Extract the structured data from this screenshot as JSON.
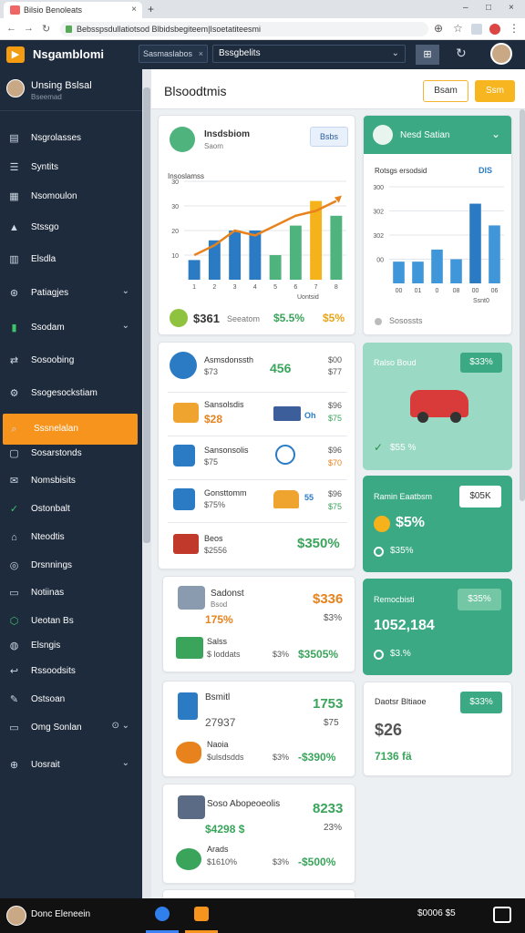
{
  "browser": {
    "tab_title": "Bilsio Benoleats",
    "tab_close": "×",
    "new_tab": "+",
    "url": "Bebsspsdullatiotsod Blbidsbegiteem|Isoetatiteesmi",
    "win_min": "–",
    "win_max": "□",
    "win_close": "×"
  },
  "appbar": {
    "app_name": "Nsgamblomi",
    "select1_value": "Sasmaslabos",
    "select1_clear": "×",
    "select2_value": "Bssgbelits"
  },
  "sidebar": {
    "user_name": "Unsing Bslsal",
    "user_sub": "Bseemad",
    "items": [
      {
        "label": "Nsgrolasses",
        "icon": "document-icon"
      },
      {
        "label": "Syntits",
        "icon": "list-icon"
      },
      {
        "label": "Nsomoulon",
        "icon": "clipboard-icon"
      },
      {
        "label": "Stssgo",
        "icon": "warning-icon"
      },
      {
        "label": "Elsdla",
        "icon": "calendar-icon"
      },
      {
        "label": "Patiagjes",
        "icon": "globe-icon",
        "chevron": "⌄"
      },
      {
        "label": "Ssodam",
        "icon": "chart-icon",
        "chevron": "⌄"
      },
      {
        "label": "Sosoobing",
        "icon": "transfer-icon"
      },
      {
        "label": "Ssogesockstiam",
        "icon": "settings-icon"
      },
      {
        "label": "Sssnelalan",
        "icon": "search-icon"
      },
      {
        "label": "Sosarstonds",
        "icon": "folder-icon"
      },
      {
        "label": "Nomsbisits",
        "icon": "message-icon"
      },
      {
        "label": "Ostonbalt",
        "icon": "check-icon"
      },
      {
        "label": "Nteodtis",
        "icon": "home-icon"
      },
      {
        "label": "Drsnnings",
        "icon": "pin-icon"
      },
      {
        "label": "Notiinas",
        "icon": "monitor-icon"
      },
      {
        "label": "Ueotan Bs",
        "icon": "shield-icon"
      },
      {
        "label": "Elsngis",
        "icon": "target-icon"
      },
      {
        "label": "Rssoodsits",
        "icon": "back-icon"
      },
      {
        "label": "Ostsoan",
        "icon": "pen-icon"
      },
      {
        "label": "Omg Sonlan",
        "icon": "monitor-icon",
        "chevron": "⊙ ⌄"
      },
      {
        "label": "Uosrait",
        "icon": "plus-icon",
        "chevron": "⌄"
      }
    ]
  },
  "header": {
    "title": "Blsoodtmis",
    "btn_outline": "Bsam",
    "btn_fill": "Ssm"
  },
  "chart_card": {
    "title": "Insdsbiom",
    "subtitle": "Saom",
    "button": "Bsbs",
    "chart_label": "Insoslamss",
    "foot_value": "$361",
    "foot_label": "Seeatom",
    "foot_green": "$5.5%",
    "foot_orange": "$5%",
    "x_caption": "Uontsid"
  },
  "chart_data": [
    {
      "type": "bar",
      "categories": [
        "1",
        "2",
        "3",
        "4",
        "5",
        "6",
        "7",
        "8"
      ],
      "series": [
        {
          "values": [
            8,
            16,
            20,
            20,
            10,
            22,
            32,
            26
          ]
        }
      ],
      "ylim": [
        0,
        40
      ],
      "yticks": [
        10,
        20,
        30,
        40
      ],
      "ytick_labels": [
        "10",
        "20",
        "30",
        "30"
      ],
      "colors": [
        "#2b7bc4",
        "#2b7bc4",
        "#2b7bc4",
        "#2b7bc4",
        "#4fb37d",
        "#4fb37d",
        "#f5b21b",
        "#4fb37d"
      ],
      "line": [
        10,
        14,
        20,
        18,
        22,
        26,
        28,
        32
      ],
      "line_color": "#e8821d"
    },
    {
      "type": "bar",
      "categories": [
        "00",
        "01",
        "0",
        "08",
        "00",
        "06"
      ],
      "series": [
        {
          "values": [
            90,
            90,
            140,
            100,
            330,
            240
          ]
        }
      ],
      "ylim": [
        0,
        400
      ],
      "yticks": [
        100,
        200,
        300,
        400
      ],
      "ytick_labels": [
        "00",
        "302",
        "302",
        "300"
      ],
      "color": "#3f96d9",
      "highlight_index": 4,
      "highlight_color": "#2b7bc4"
    }
  ],
  "rc_chart_card": {
    "title": "Nesd Satian",
    "chart_label": "Rotsgs ersodsid",
    "badge": "DIS",
    "foot": "Sosossts",
    "x_caption": "Ssnt0"
  },
  "list_card1": {
    "items": [
      {
        "title": "Asmsdonssth",
        "value": "$73",
        "green": "456",
        "right1": "$00",
        "right2": "$77"
      },
      {
        "title": "Sansolsdis",
        "value": "$28",
        "mid": "Oh",
        "right1": "$96",
        "right2": "$75"
      },
      {
        "title": "Sansonsolis",
        "value": "$75",
        "mid": "",
        "right1": "$96",
        "right2": "$70"
      },
      {
        "title": "Gonsttomm",
        "value": "$75%",
        "mid": "55",
        "right1": "$96",
        "right2": "$75"
      },
      {
        "title": "Beos",
        "value": "$2556",
        "green": "$350%"
      }
    ]
  },
  "teal_card1": {
    "title": "Ralso Boud",
    "badge": "$33%",
    "foot": "$55 %"
  },
  "card_a": {
    "title": "Sadonst",
    "sub": "Bsod",
    "orange": "$336",
    "value": "175%",
    "right": "$3%",
    "row_title": "Salss",
    "row_sub": "$ loddats",
    "row_small": "$3%",
    "row_green": "$3505%"
  },
  "teal_card2": {
    "title": "Ramin Eaatbsm",
    "badge": "$05K",
    "big": "$5%",
    "foot": "$35%"
  },
  "teal_card3": {
    "title": "Remocbisti",
    "badge": "$35%",
    "big": "1052,184",
    "foot": "$3.%"
  },
  "card_b": {
    "title": "Bsmitl",
    "value": "27937",
    "green": "1753",
    "right": "$75",
    "row_title": "Naoia",
    "row_sub": "$ulsdsdds",
    "row_small": "$3%",
    "row_green": "-$390%"
  },
  "white_card": {
    "title": "Daotsr Bltiaoe",
    "badge": "$33%",
    "big": "$26",
    "foot": "7136 fä"
  },
  "card_c": {
    "title": "Soso Abopeoeolis",
    "value": "$4298 $",
    "green": "8233",
    "right": "23%",
    "row_title": "Arads",
    "row_sub": "$1610%",
    "row_small": "$3%",
    "row_green": "-$500%"
  },
  "footer": {
    "user": "Donc Eleneein",
    "status": "$0006 $5"
  }
}
